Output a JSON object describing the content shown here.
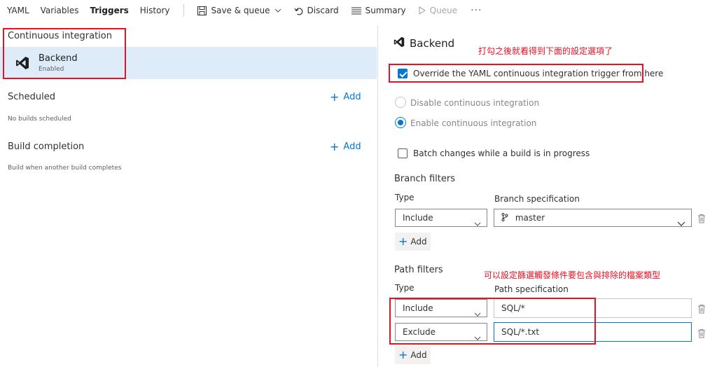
{
  "tabs": [
    {
      "label": "YAML"
    },
    {
      "label": "Variables"
    },
    {
      "label": "Triggers"
    },
    {
      "label": "History"
    }
  ],
  "toolbar": {
    "save_label": "Save & queue",
    "discard_label": "Discard",
    "summary_label": "Summary",
    "queue_label": "Queue",
    "more": "···"
  },
  "left": {
    "ci_title": "Continuous integration",
    "ci_item": {
      "name": "Backend",
      "status": "Enabled"
    },
    "scheduled_title": "Scheduled",
    "scheduled_sub": "No builds scheduled",
    "completion_title": "Build completion",
    "completion_sub": "Build when another build completes",
    "add_label": "Add"
  },
  "right": {
    "title": "Backend",
    "annotation_top": "打勾之後就看得到下面的設定選項了",
    "override_label": "Override the YAML continuous integration trigger from here",
    "disable_ci_label": "Disable continuous integration",
    "enable_ci_label": "Enable continuous integration",
    "batch_label": "Batch changes while a build is in progress",
    "branch_filters": {
      "title": "Branch filters",
      "type_label": "Type",
      "spec_label": "Branch specification",
      "type_value": "Include",
      "spec_value": "master",
      "add_label": "Add"
    },
    "path_filters": {
      "title": "Path filters",
      "annotation": "可以設定篩選觸發條件要包含與排除的檔案類型",
      "type_label": "Type",
      "spec_label": "Path specification",
      "rows": [
        {
          "type": "Include",
          "spec": "SQL/*"
        },
        {
          "type": "Exclude",
          "spec": "SQL/*.txt"
        }
      ],
      "add_label": "Add"
    }
  },
  "colors": {
    "accent": "#0078d4",
    "annotation": "#e81123",
    "selected_bg": "#deecf9"
  }
}
